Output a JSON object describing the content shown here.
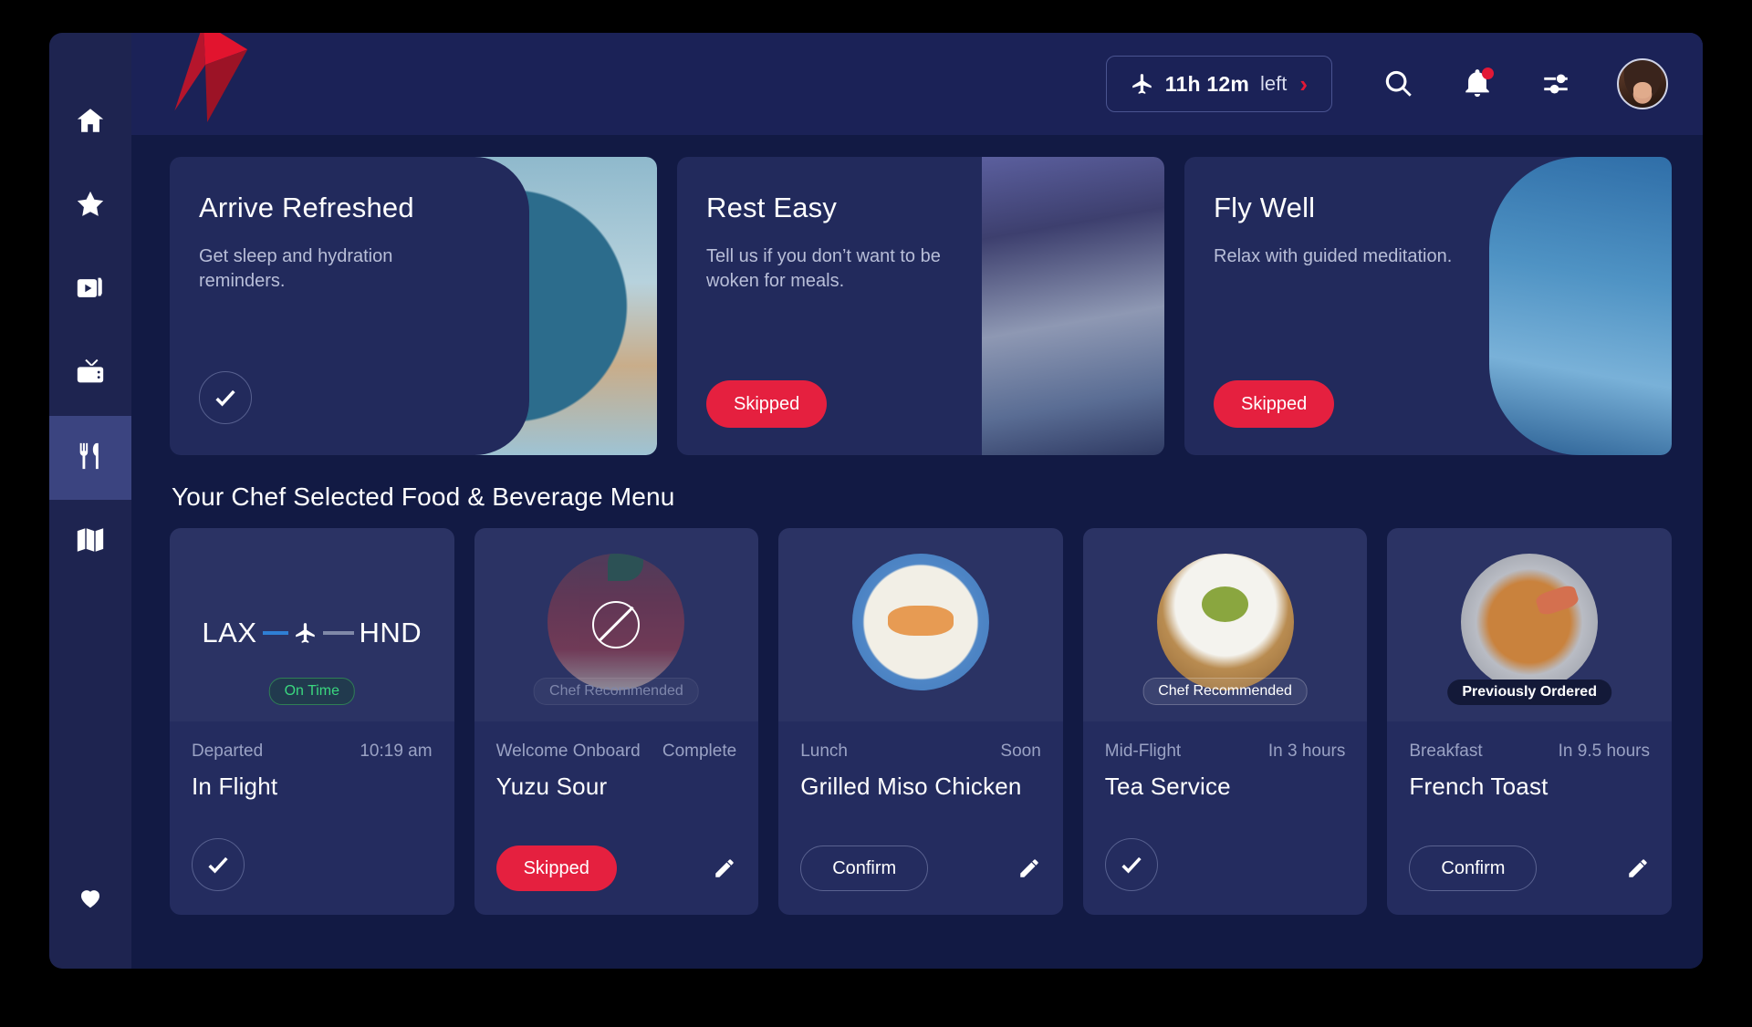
{
  "header": {
    "logo_name": "delta-widget-logo",
    "flight_status": {
      "icon": "airplane-icon",
      "time_remaining": "11h 12m",
      "suffix": "left",
      "chevron": "›"
    },
    "icons": {
      "search": "search-icon",
      "notifications": "bell-icon",
      "settings": "sliders-icon",
      "avatar": "user-avatar"
    },
    "notification_badge": true
  },
  "sidebar": {
    "items": [
      {
        "name": "home",
        "icon": "home-icon",
        "active": false
      },
      {
        "name": "favorites",
        "icon": "star-icon",
        "active": false
      },
      {
        "name": "movies",
        "icon": "movie-ticket-icon",
        "active": false
      },
      {
        "name": "tv",
        "icon": "tv-icon",
        "active": false
      },
      {
        "name": "dining",
        "icon": "fork-knife-icon",
        "active": true
      },
      {
        "name": "map",
        "icon": "map-icon",
        "active": false
      }
    ],
    "bottom_item": {
      "name": "saved",
      "icon": "heart-icon"
    }
  },
  "hero_cards": [
    {
      "title": "Arrive Refreshed",
      "subtitle": "Get sleep and hydration reminders.",
      "action_type": "check",
      "action_label": "",
      "art": "water-glass-image"
    },
    {
      "title": "Rest Easy",
      "subtitle": "Tell us if you don’t want to be woken for meals.",
      "action_type": "skipped",
      "action_label": "Skipped",
      "art": "sleeping-passenger-image"
    },
    {
      "title": "Fly Well",
      "subtitle": "Relax with guided meditation.",
      "action_type": "skipped",
      "action_label": "Skipped",
      "art": "sky-clouds-image"
    }
  ],
  "menu": {
    "section_title": "Your Chef Selected Food & Beverage Menu",
    "cards": [
      {
        "kind": "flight",
        "origin": "LAX",
        "destination": "HND",
        "badge": "On Time",
        "badge_style": "ontime",
        "meta_left": "Departed",
        "meta_right": "10:19 am",
        "title": "In Flight",
        "action_type": "check",
        "action_label": "",
        "has_pencil": false,
        "image": "route-plane-icon"
      },
      {
        "kind": "item",
        "badge": "Chef Recommended",
        "badge_style": "chef-dim",
        "meta_left": "Welcome Onboard",
        "meta_right": "Complete",
        "title": "Yuzu Sour",
        "action_type": "skipped",
        "action_label": "Skipped",
        "has_pencil": true,
        "image": "yuzu-sour-cocktail-image",
        "skipped_overlay": true
      },
      {
        "kind": "item",
        "badge": "",
        "badge_style": "none",
        "meta_left": "Lunch",
        "meta_right": "Soon",
        "title": "Grilled Miso Chicken",
        "action_type": "confirm",
        "action_label": "Confirm",
        "has_pencil": true,
        "image": "grilled-miso-chicken-image",
        "skipped_overlay": false
      },
      {
        "kind": "item",
        "badge": "Chef Recommended",
        "badge_style": "chef",
        "meta_left": "Mid-Flight",
        "meta_right": "In 3 hours",
        "title": "Tea Service",
        "action_type": "check",
        "action_label": "",
        "has_pencil": false,
        "image": "green-tea-cup-image",
        "skipped_overlay": false
      },
      {
        "kind": "item",
        "badge": "Previously Ordered",
        "badge_style": "prev",
        "meta_left": "Breakfast",
        "meta_right": "In 9.5 hours",
        "title": "French Toast",
        "action_type": "confirm",
        "action_label": "Confirm",
        "has_pencil": true,
        "image": "french-toast-image",
        "skipped_overlay": false
      }
    ]
  },
  "colors": {
    "brand_red": "#e5203f",
    "app_bg": "#121a44",
    "sidebar_bg": "#1e2450",
    "header_bg": "#1b2257",
    "card_bg": "#242c5f",
    "hero_bg": "#222a5c",
    "ontime_green": "#3ad77f",
    "accent_blue": "#2f7fd4"
  }
}
